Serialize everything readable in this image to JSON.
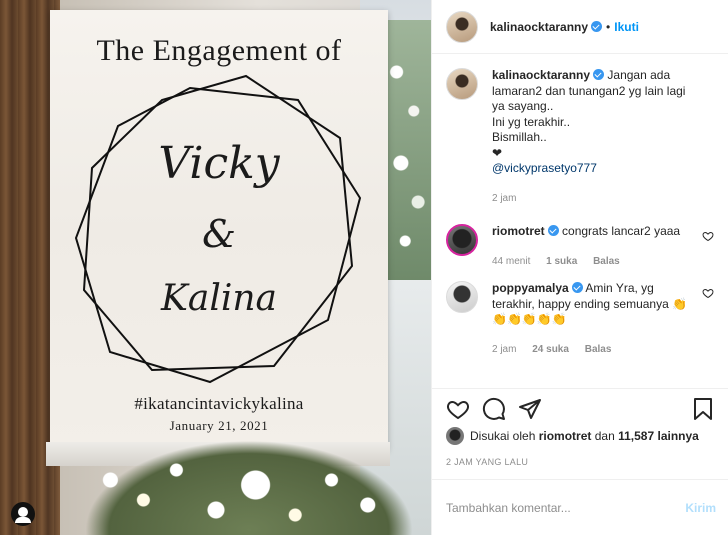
{
  "photo": {
    "sign": {
      "title": "The Engagement of",
      "name1": "Vicky",
      "ampersand": "&",
      "name2": "Kalina",
      "hashtag": "#ikatancintavickykalina",
      "date": "January 21, 2021"
    }
  },
  "header": {
    "username": "kalinaocktaranny",
    "separator": "•",
    "follow_label": "Ikuti",
    "more_icon": "more-horizontal-icon"
  },
  "caption": {
    "username": "kalinaocktaranny",
    "text_line1": "Jangan ada lamaran2 dan tunangan2 yg lain lagi ya sayang..",
    "text_line2": "Ini yg terakhir..",
    "text_line3": "Bismillah..",
    "text_line4": "❤",
    "mention": "@vickyprasetyo777",
    "time": "2 jam"
  },
  "comments": [
    {
      "username": "riomotret",
      "text": "congrats lancar2 yaaa",
      "time": "44 menit",
      "likes": "1 suka",
      "reply": "Balas"
    },
    {
      "username": "poppyamalya",
      "text": "Amin Yra, yg terakhir, happy ending semuanya 👏👏👏👏👏👏",
      "time": "2 jam",
      "likes": "24 suka",
      "reply": "Balas"
    }
  ],
  "likes": {
    "prefix": "Disukai oleh",
    "user": "riomotret",
    "middle": "dan",
    "count": "11,587 lainnya"
  },
  "timeago": "2 JAM YANG LALU",
  "add_comment": {
    "placeholder": "Tambahkan komentar...",
    "post_label": "Kirim"
  },
  "colors": {
    "accent": "#0095f6",
    "verified": "#3897f0",
    "post_disabled": "#b2dffc",
    "muted": "#8e8e8e"
  }
}
